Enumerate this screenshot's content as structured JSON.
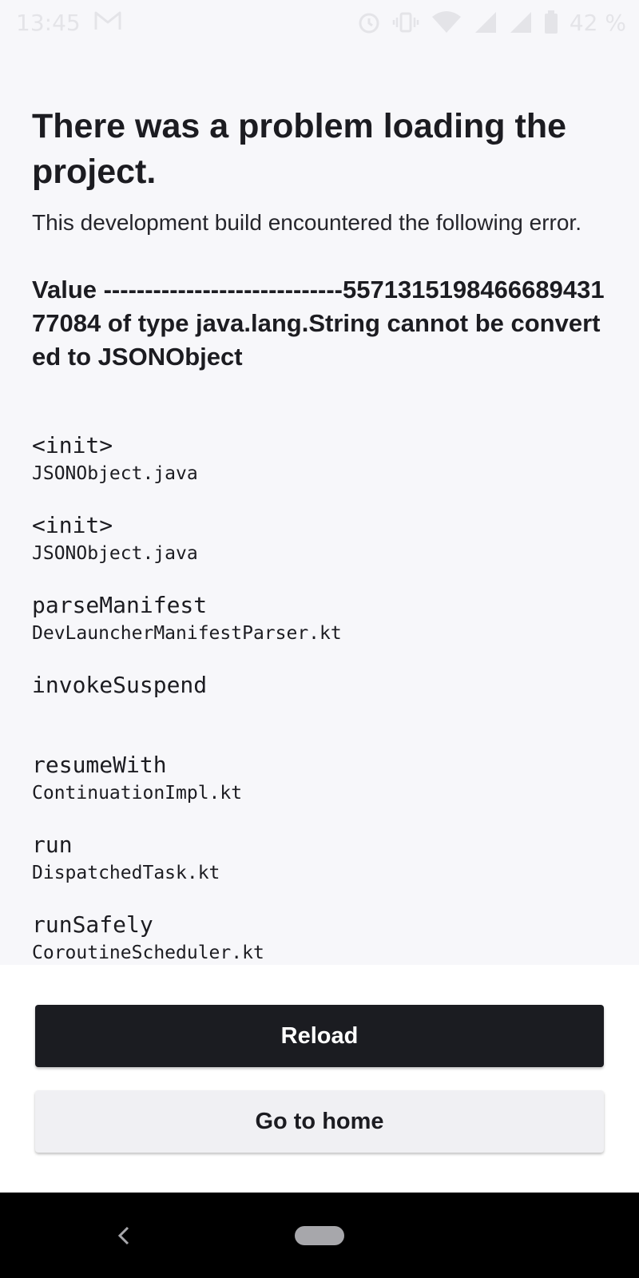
{
  "status_bar": {
    "time": "13:45",
    "battery_text": "42 %",
    "icons": [
      "mail-icon",
      "alarm-icon",
      "vibrate-icon",
      "wifi-icon",
      "signal-icon",
      "signal-icon",
      "battery-icon"
    ]
  },
  "error_screen": {
    "title": "There was a problem loading the project.",
    "subtitle": "This development build encountered the following error.",
    "message": "Value -----------------------------557131519846668943177084 of type java.lang.String cannot be converted to JSONObject",
    "stack": [
      {
        "method": "<init>",
        "file": "JSONObject.java"
      },
      {
        "method": "<init>",
        "file": "JSONObject.java"
      },
      {
        "method": "parseManifest",
        "file": "DevLauncherManifestParser.kt"
      },
      {
        "method": "invokeSuspend",
        "file": ""
      },
      {
        "method": "resumeWith",
        "file": "ContinuationImpl.kt"
      },
      {
        "method": "run",
        "file": "DispatchedTask.kt"
      },
      {
        "method": "runSafely",
        "file": "CoroutineScheduler.kt"
      }
    ]
  },
  "actions": {
    "reload_label": "Reload",
    "home_label": "Go to home"
  },
  "colors": {
    "background": "#f7f7fa",
    "primary_button": "#1b1c21",
    "secondary_button": "#f0f0f3",
    "text": "#1c1c21"
  }
}
